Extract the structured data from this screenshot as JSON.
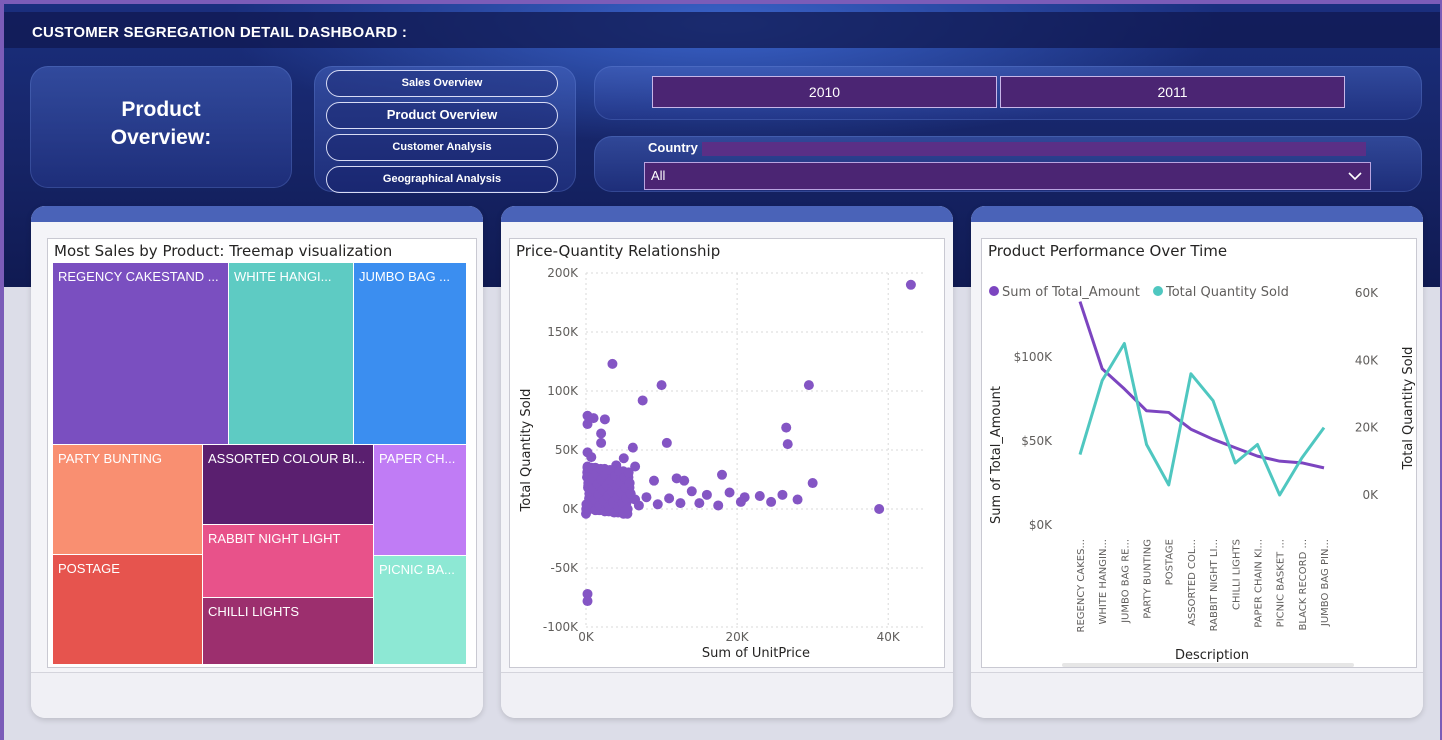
{
  "header": {
    "title": "CUSTOMER SEGREGATION DETAIL DASHBOARD :"
  },
  "page_heading": {
    "line1": "Product",
    "line2": "Overview:"
  },
  "nav": {
    "sales": "Sales Overview",
    "product": "Product Overview",
    "customer": "Customer Analysis",
    "geo": "Geographical Analysis"
  },
  "years": {
    "y2010": "2010",
    "y2011": "2011"
  },
  "country_filter": {
    "label": "Country",
    "value": "All"
  },
  "treemap": {
    "title": "Most Sales by Product: Treemap visualization",
    "tiles": [
      {
        "label": "REGENCY CAKESTAND ...",
        "color": "#7a4fc0"
      },
      {
        "label": "WHITE HANGI...",
        "color": "#5ecbc3"
      },
      {
        "label": "JUMBO BAG ...",
        "color": "#3b8ef0"
      },
      {
        "label": "PARTY BUNTING",
        "color": "#f98f71"
      },
      {
        "label": "ASSORTED COLOUR BI...",
        "color": "#5a1f6f"
      },
      {
        "label": "PAPER CH...",
        "color": "#c07cf5"
      },
      {
        "label": "RABBIT NIGHT LIGHT",
        "color": "#e8528a"
      },
      {
        "label": "POSTAGE",
        "color": "#e6544e"
      },
      {
        "label": "CHILLI LIGHTS",
        "color": "#9c2f6e"
      },
      {
        "label": "PICNIC BA...",
        "color": "#8de8d4"
      }
    ]
  },
  "chart_data": [
    {
      "type": "scatter",
      "title": "Price-Quantity Relationship",
      "xlabel": "Sum of UnitPrice",
      "ylabel": "Total Quantity Sold",
      "xlim": [
        0,
        45000
      ],
      "ylim": [
        -100000,
        200000
      ],
      "x_ticks": [
        "0K",
        "20K",
        "40K"
      ],
      "y_ticks": [
        "200K",
        "150K",
        "100K",
        "50K",
        "0K",
        "-50K",
        "-100K"
      ],
      "color": "#8455c4",
      "points": [
        [
          43000,
          190000
        ],
        [
          3500,
          123000
        ],
        [
          10000,
          105000
        ],
        [
          29500,
          105000
        ],
        [
          7500,
          92000
        ],
        [
          200,
          79000
        ],
        [
          1000,
          77000
        ],
        [
          2500,
          76000
        ],
        [
          200,
          72000
        ],
        [
          26500,
          69000
        ],
        [
          2000,
          64000
        ],
        [
          2000,
          56000
        ],
        [
          26700,
          55000
        ],
        [
          10700,
          56000
        ],
        [
          6200,
          52000
        ],
        [
          200,
          48000
        ],
        [
          700,
          44000
        ],
        [
          5000,
          43000
        ],
        [
          4000,
          37000
        ],
        [
          6500,
          36000
        ],
        [
          200,
          36000
        ],
        [
          300,
          31000
        ],
        [
          1500,
          33000
        ],
        [
          3000,
          29000
        ],
        [
          5000,
          30000
        ],
        [
          12000,
          26000
        ],
        [
          18000,
          29000
        ],
        [
          9000,
          24000
        ],
        [
          13000,
          24000
        ],
        [
          16000,
          12000
        ],
        [
          19000,
          14000
        ],
        [
          21000,
          10000
        ],
        [
          23000,
          11000
        ],
        [
          26000,
          12000
        ],
        [
          28000,
          8000
        ],
        [
          30000,
          22000
        ],
        [
          38800,
          0
        ],
        [
          20500,
          6000
        ],
        [
          24500,
          6000
        ],
        [
          15000,
          5000
        ],
        [
          11000,
          9000
        ],
        [
          8000,
          10000
        ],
        [
          6500,
          8000
        ],
        [
          14000,
          15000
        ],
        [
          200,
          -72000
        ],
        [
          200,
          -78000
        ],
        [
          300,
          20000
        ],
        [
          600,
          12000
        ],
        [
          1000,
          4000
        ],
        [
          1500,
          16000
        ],
        [
          2000,
          8000
        ],
        [
          2500,
          2000
        ],
        [
          3000,
          10000
        ],
        [
          4000,
          5000
        ],
        [
          5500,
          14000
        ],
        [
          7000,
          3000
        ],
        [
          9500,
          4000
        ],
        [
          12500,
          5000
        ],
        [
          17500,
          3000
        ],
        [
          400,
          25000
        ]
      ]
    },
    {
      "type": "line",
      "title": "Product Performance Over Time",
      "xlabel": "Description",
      "ylabel": "Sum of Total_Amount",
      "y2label": "Total Quantity Sold",
      "categories": [
        "REGENCY CAKES...",
        "WHITE HANGIN...",
        "JUMBO BAG RE...",
        "PARTY BUNTING",
        "POSTAGE",
        "ASSORTED COL...",
        "RABBIT NIGHT LI...",
        "CHILLI LIGHTS",
        "PAPER CHAIN KI...",
        "PICNIC BASKET ...",
        "BLACK RECORD ...",
        "JUMBO BAG PIN..."
      ],
      "y_ticks": [
        "$100K",
        "$50K",
        "$0K"
      ],
      "y2_ticks": [
        "60K",
        "40K",
        "20K",
        "0K"
      ],
      "ylim": [
        0,
        100000
      ],
      "y2lim": [
        0,
        40000
      ],
      "legend_position": "top-left",
      "series": [
        {
          "name": "Sum of Total_Amount",
          "axis": "left",
          "color": "#7c45c0",
          "values": [
            133000,
            93000,
            81000,
            68000,
            67000,
            57000,
            51000,
            46000,
            41000,
            38000,
            37000,
            34000
          ]
        },
        {
          "name": "Total Quantity Sold",
          "axis": "right",
          "color": "#4fc7c0",
          "values": [
            12000,
            34000,
            45000,
            15000,
            3000,
            36000,
            28000,
            9500,
            15000,
            0,
            11000,
            20000
          ]
        }
      ]
    }
  ]
}
